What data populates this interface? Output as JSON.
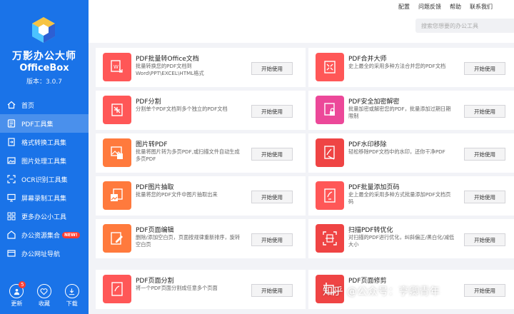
{
  "app": {
    "name": "万影办公大师",
    "name_en": "OfficeBox",
    "version": "版本：3.0.7"
  },
  "toplinks": [
    "配置",
    "问题反馈",
    "帮助",
    "联系我们"
  ],
  "search": {
    "placeholder": "搜索您想要的办公工具"
  },
  "sidebar": {
    "items": [
      {
        "label": "首页",
        "icon": "home-icon"
      },
      {
        "label": "PDF工具集",
        "icon": "pdf-icon",
        "active": true
      },
      {
        "label": "格式转换工具集",
        "icon": "convert-icon"
      },
      {
        "label": "图片处理工具集",
        "icon": "image-icon"
      },
      {
        "label": "OCR识别工具集",
        "icon": "ocr-icon"
      },
      {
        "label": "屏幕录制工具集",
        "icon": "screen-icon"
      },
      {
        "label": "更多办公小工具",
        "icon": "grid-icon"
      },
      {
        "label": "办公资源集合",
        "icon": "resource-icon",
        "badge": "NEW!"
      },
      {
        "label": "办公网址导航",
        "icon": "link-icon"
      }
    ],
    "bottom": [
      {
        "label": "更新",
        "badge": "5",
        "icon": "update-icon"
      },
      {
        "label": "收藏",
        "icon": "heart-icon"
      },
      {
        "label": "下载",
        "icon": "download-icon"
      }
    ]
  },
  "tools": [
    {
      "title": "PDF批量转Office文档",
      "desc": "批量转换您的PDF文档到Word\\PPT\\EXCEL\\HTML格式",
      "button": "开始使用",
      "color": "#ff5757",
      "icon": "convert-doc-icon"
    },
    {
      "title": "PDF合并大师",
      "desc": "史上最全的采用多种方法合并您的PDF文档",
      "button": "开始使用",
      "color": "#ff5757",
      "icon": "merge-icon"
    },
    {
      "title": "PDF分割",
      "desc": "分割单个PDF文档到多个独立的PDF文档",
      "button": "开始使用",
      "color": "#ff5757",
      "icon": "split-icon"
    },
    {
      "title": "PDF安全加密解密",
      "desc": "批量加密或解密您的PDF，批量添加过期日期限制",
      "button": "开始使用",
      "color": "#ec4899",
      "icon": "lock-icon"
    },
    {
      "title": "图片转PDF",
      "desc": "批量将图片转为多页PDF,或扫描文件自动生成多页PDF",
      "button": "开始使用",
      "color": "#ff7a3d",
      "icon": "image-pdf-icon"
    },
    {
      "title": "PDF水印移除",
      "desc": "轻松移除PDF文档中的水印，还你干净PDF",
      "button": "开始使用",
      "color": "#ef4444",
      "icon": "watermark-icon"
    },
    {
      "title": "PDF图片抽取",
      "desc": "批量将您的PDF文件中图片抽取出来",
      "button": "开始使用",
      "color": "#ff7a3d",
      "icon": "extract-icon"
    },
    {
      "title": "PDF批量添加页码",
      "desc": "史上最全的采用多种方式批量添加PDF文档页码",
      "button": "开始使用",
      "color": "#ff5757",
      "icon": "page-num-icon"
    },
    {
      "title": "PDF页面编辑",
      "desc": "删除/添加空白页，页面按规律重新排序，旋转空白页",
      "button": "开始使用",
      "color": "#ff7a3d",
      "icon": "edit-icon"
    },
    {
      "title": "扫描PDF转优化",
      "desc": "对扫描的PDF进行优化，纠斜偏正/黑白化/减低大小",
      "button": "开始使用",
      "color": "#ef4444",
      "icon": "scan-icon"
    },
    {
      "title": "PDF页面分割",
      "desc": "将一个PDF页面分割成任意多个页面",
      "button": "开始使用",
      "color": "#ff5757",
      "icon": "page-split-icon"
    },
    {
      "title": "PDF页面修剪",
      "desc": "",
      "button": "开始使用",
      "color": "#ef4444",
      "icon": "crop-icon"
    }
  ],
  "watermark": "知乎 @公众号：亨卿青年"
}
